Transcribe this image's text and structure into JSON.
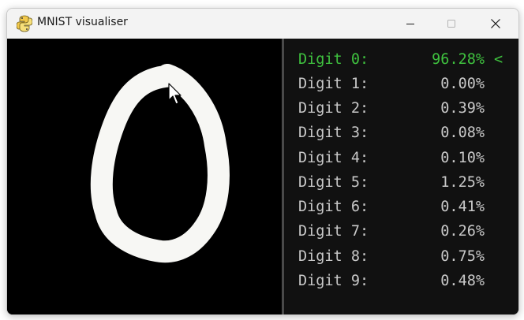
{
  "window": {
    "title": "MNIST visualiser",
    "icon": "python-snake-icon"
  },
  "controls": {
    "minimize_icon": "minimize-icon",
    "maximize_icon": "maximize-icon",
    "close_icon": "close-icon"
  },
  "colors": {
    "highlight": "#3fc23f",
    "normal_text": "#c9c9c9",
    "stroke": "#f7f7f4",
    "canvas_bg": "#000000"
  },
  "predictions": [
    {
      "label": "Digit 0:",
      "pct": "96.28%",
      "marker": "<"
    },
    {
      "label": "Digit 1:",
      "pct": "0.00%",
      "marker": ""
    },
    {
      "label": "Digit 2:",
      "pct": "0.39%",
      "marker": ""
    },
    {
      "label": "Digit 3:",
      "pct": "0.08%",
      "marker": ""
    },
    {
      "label": "Digit 4:",
      "pct": "0.10%",
      "marker": ""
    },
    {
      "label": "Digit 5:",
      "pct": "1.25%",
      "marker": ""
    },
    {
      "label": "Digit 6:",
      "pct": "0.41%",
      "marker": ""
    },
    {
      "label": "Digit 7:",
      "pct": "0.26%",
      "marker": ""
    },
    {
      "label": "Digit 8:",
      "pct": "0.75%",
      "marker": ""
    },
    {
      "label": "Digit 9:",
      "pct": "0.48%",
      "marker": ""
    }
  ],
  "top_prediction_index": 0
}
